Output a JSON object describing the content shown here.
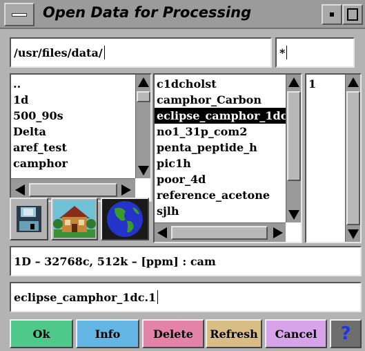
{
  "window": {
    "title": "Open Data for Processing"
  },
  "filter": {
    "path": "/usr/files/data/",
    "pattern": "*"
  },
  "directories": [
    "..",
    "1d",
    "500_90s",
    "Delta",
    "aref_test",
    "camphor"
  ],
  "files": [
    "c1dcholst",
    "camphor_Carbon",
    "eclipse_camphor_1dc",
    "no1_31p_com2",
    "penta_peptide_h",
    "pic1h",
    "poor_4d",
    "reference_acetone",
    "sjlh"
  ],
  "selected_file": "eclipse_camphor_1dc",
  "experiments": [
    "1"
  ],
  "info_line": "1D – 32768c, 512k – [ppm] : cam",
  "selection": "eclipse_camphor_1dc.1",
  "buttons": {
    "ok": "Ok",
    "info": "Info",
    "delete": "Delete",
    "refresh": "Refresh",
    "cancel": "Cancel",
    "help": "?"
  },
  "icons": [
    "floppy-disk-icon",
    "house-icon",
    "globe-icon"
  ],
  "colors": {
    "ok": "#4fc98a",
    "info": "#63b6e4",
    "delete": "#e383a8",
    "refresh": "#d8be84",
    "cancel": "#d7a4e9",
    "help": "#6e6e6e",
    "help_mark": "#2233dd"
  }
}
